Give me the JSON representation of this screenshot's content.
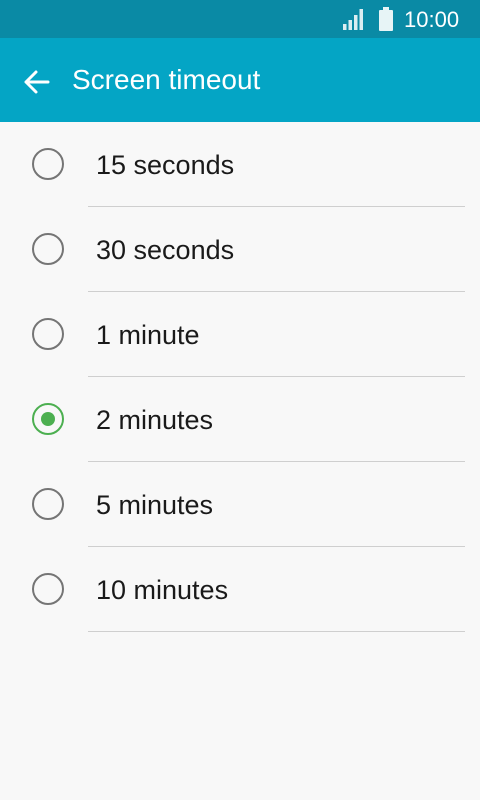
{
  "status_bar": {
    "time": "10:00",
    "signal_icon": "signal-icon",
    "battery_icon": "battery-icon"
  },
  "header": {
    "title": "Screen timeout",
    "back_icon": "arrow-back-icon",
    "color": "#04a5c5"
  },
  "options": [
    {
      "label": "15 seconds",
      "selected": false
    },
    {
      "label": "30 seconds",
      "selected": false
    },
    {
      "label": "1 minute",
      "selected": false
    },
    {
      "label": "2 minutes",
      "selected": true
    },
    {
      "label": "5 minutes",
      "selected": false
    },
    {
      "label": "10 minutes",
      "selected": false
    }
  ],
  "accent_color": "#4caf50"
}
